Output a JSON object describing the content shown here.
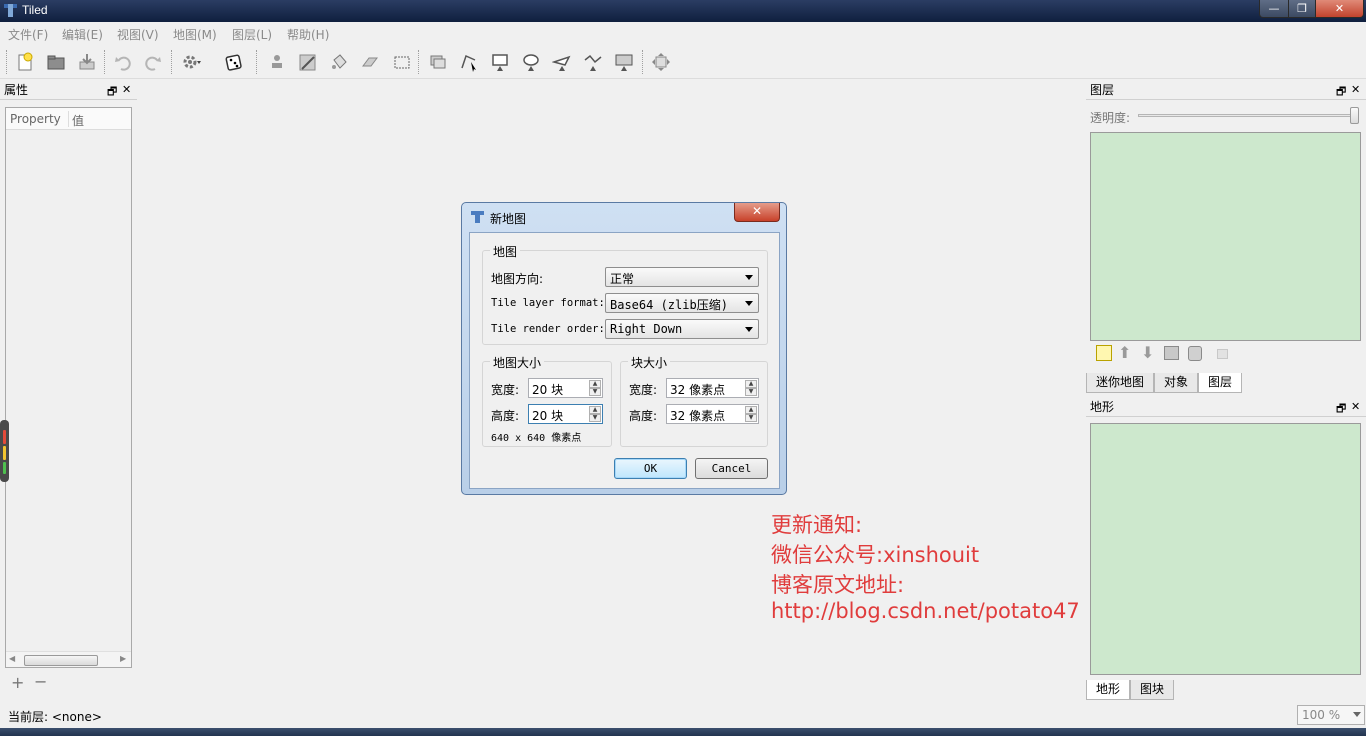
{
  "window": {
    "title": "Tiled",
    "min_glyph": "—",
    "max_glyph": "❐",
    "close_glyph": "✕"
  },
  "menu": [
    "文件(F)",
    "编辑(E)",
    "视图(V)",
    "地图(M)",
    "图层(L)",
    "帮助(H)"
  ],
  "toolbar_icons": [
    "new-map-icon",
    "open-icon",
    "save-icon",
    "undo-icon",
    "redo-icon",
    "command-icon",
    "random-dice-icon",
    "stamp-brush-icon",
    "terrain-brush-icon",
    "bucket-fill-icon",
    "eraser-icon",
    "rect-select-icon",
    "select-tile-icon",
    "edit-polygon-icon",
    "insert-rect-icon",
    "insert-ellipse-icon",
    "insert-polygon-icon",
    "insert-polyline-icon",
    "insert-tile-icon",
    "fit-map-icon"
  ],
  "properties_panel": {
    "title": "属性",
    "col_property": "Property",
    "col_value": "值",
    "float_glyph": "🗗",
    "close_glyph": "✕"
  },
  "layers_panel": {
    "title": "图层",
    "opacity_label": "透明度:",
    "tabs": [
      "迷你地图",
      "对象",
      "图层"
    ],
    "active_tab": 2
  },
  "terrain_panel": {
    "title": "地形",
    "tabs": [
      "地形",
      "图块"
    ],
    "active_tab": 0
  },
  "status": {
    "current_layer": "当前层: <none>",
    "zoom": "100 %"
  },
  "dialog": {
    "title": "新地图",
    "close_glyph": "✕",
    "map_group": "地图",
    "orientation_label": "地图方向:",
    "orientation_value": "正常",
    "layer_format_label": "Tile layer format:",
    "layer_format_value": "Base64 (zlib压缩)",
    "render_order_label": "Tile render order:",
    "render_order_value": "Right Down",
    "map_size_group": "地图大小",
    "map_width_label": "宽度:",
    "map_width_value": "20 块",
    "map_height_label": "高度:",
    "map_height_value": "20 块",
    "map_pixel_size": "640 x 640 像素点",
    "tile_size_group": "块大小",
    "tile_width_label": "宽度:",
    "tile_width_value": "32 像素点",
    "tile_height_label": "高度:",
    "tile_height_value": "32 像素点",
    "ok": "OK",
    "cancel": "Cancel"
  },
  "overlay_note": {
    "line1": "更新通知:",
    "line2": "微信公众号:xinshouit",
    "line3": "博客原文地址:",
    "line4": "http://blog.csdn.net/potato47"
  },
  "colors": {
    "title_bar": "#1c2c4c",
    "panel_green": "#cde8cd",
    "note_red": "#e03c3c",
    "dialog_frame": "#b9cfe8"
  }
}
